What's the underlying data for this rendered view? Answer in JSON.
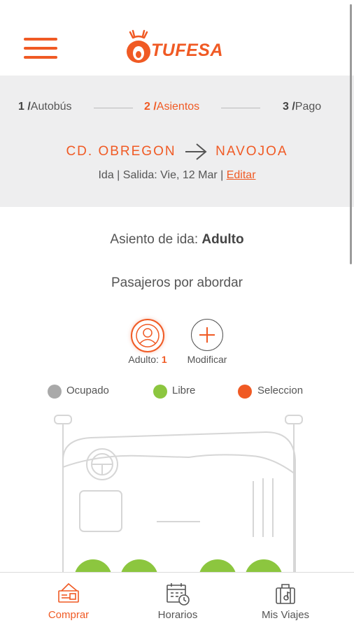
{
  "header": {
    "menu_icon": "hamburger-menu-icon",
    "logo_text": "TUFESA"
  },
  "stepper": {
    "steps": [
      {
        "number": "1 /",
        "label": "Autobús"
      },
      {
        "number": "2 /",
        "label": "Asientos"
      },
      {
        "number": "3 /",
        "label": "Pago"
      }
    ],
    "active_step": 2
  },
  "trip": {
    "origin": "CD. OBREGON",
    "destination": "NAVOJOA",
    "departure_text": "Ida | Salida: Vie, 12 Mar |",
    "edit_link": "Editar"
  },
  "seat_section": {
    "title_prefix": "Asiento de ida:",
    "title_type": "Adulto",
    "passengers_title": "Pasajeros por abordar",
    "adult_label": "Adulto:",
    "adult_count": "1",
    "modify_label": "Modificar"
  },
  "legend": {
    "occupied": "Ocupado",
    "free": "Libre",
    "selected": "Seleccion"
  },
  "colors": {
    "accent": "#f05a24",
    "occupied": "#a9a9a9",
    "free": "#8cc63f",
    "selected": "#f05a24",
    "stepper_bg": "#eeeeef"
  },
  "bottom_nav": {
    "items": [
      {
        "label": "Comprar",
        "icon": "ticket-icon",
        "active": true
      },
      {
        "label": "Horarios",
        "icon": "calendar-clock-icon",
        "active": false
      },
      {
        "label": "Mis Viajes",
        "icon": "luggage-icon",
        "active": false
      }
    ]
  }
}
